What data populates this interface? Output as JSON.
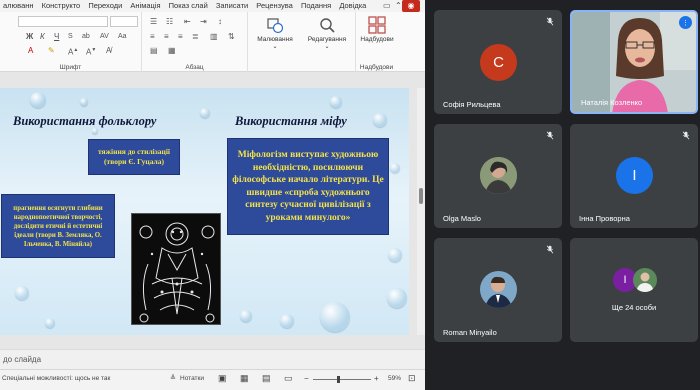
{
  "menubar": {
    "items": [
      "алюванн",
      "Конструкто",
      "Переходи",
      "Анімація",
      "Показ слай",
      "Записати",
      "Рецензува",
      "Подання",
      "Довідка"
    ]
  },
  "ribbon": {
    "groups": {
      "font": "Шрифт",
      "paragraph": "Абзац",
      "drawing": "Малювання",
      "editing": "Редагування",
      "addins": "Надбудови",
      "addins_group": "Надбудови"
    }
  },
  "slide": {
    "heading_left": "Використання фольклору",
    "heading_right": "Використання міфу",
    "box_stylization": "тяжіння до стилізації (твори Є. Гуцала)",
    "box_deep_folk": "прагнення осягнути глибини народнопоетичної творчості, дослідити етичні й естетичні ідеали (твори В. Земляка, О. Ільченка, В. Міняйла)",
    "box_myth": "Міфологізм виступає художньою необхідністю, посилюючи філософське начало літератури. Це швидше «спроба художнього синтезу сучасної цивілізації з уроками минулого»"
  },
  "notes": {
    "placeholder": "до слайда"
  },
  "status": {
    "accessibility": "Спеціальні можливості: щось не так",
    "notes_button": "Нотатки",
    "zoom": "59%"
  },
  "participants": [
    {
      "name": "Софія Рильцева",
      "initial": "С",
      "color": "#c5391c"
    },
    {
      "name": "Наталія Козленко"
    },
    {
      "name": "Olga Maslo"
    },
    {
      "name": "Інна Проворна",
      "initial": "І",
      "color": "#1a73e8"
    },
    {
      "name": "Roman Minyailo"
    },
    {
      "name": "Ще 24 особи",
      "initial": "І",
      "color": "#7b1fa2"
    }
  ],
  "colors": {
    "meet_bg": "#202124",
    "tile_bg": "#3c4043",
    "slide_box": "#2e4a9a",
    "slide_box_text": "#f3e24a"
  }
}
